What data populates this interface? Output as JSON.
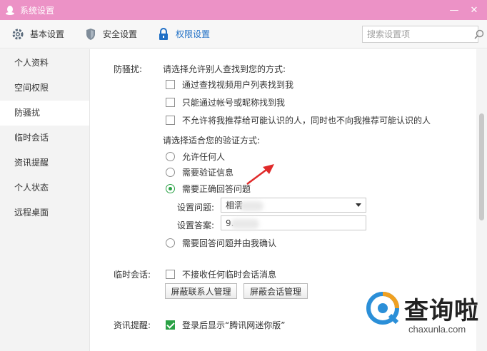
{
  "window": {
    "title": "系统设置",
    "minimize": "—",
    "close": "✕"
  },
  "toolbar": {
    "items": [
      {
        "label": "基本设置",
        "icon": "gear-icon"
      },
      {
        "label": "安全设置",
        "icon": "shield-icon"
      },
      {
        "label": "权限设置",
        "icon": "lock-icon",
        "active": true
      }
    ],
    "search_placeholder": "搜索设置项"
  },
  "sidebar": {
    "items": [
      {
        "label": "个人资料"
      },
      {
        "label": "空间权限"
      },
      {
        "label": "防骚扰",
        "active": true
      },
      {
        "label": "临时会话"
      },
      {
        "label": "资讯提醒"
      },
      {
        "label": "个人状态"
      },
      {
        "label": "远程桌面"
      }
    ]
  },
  "anti_harass": {
    "label": "防骚扰:",
    "find_prompt": "请选择允许别人查找到您的方式:",
    "find_options": [
      "通过查找视频用户列表找到我",
      "只能通过帐号或昵称找到我",
      "不允许将我推荐给可能认识的人，同时也不向我推荐可能认识的人"
    ],
    "verify_prompt": "请选择适合您的验证方式:",
    "verify_options": [
      "允许任何人",
      "需要验证信息",
      "需要正确回答问题",
      "需要回答问题并由我确认"
    ],
    "question_label": "设置问题:",
    "question_value": "相濡",
    "answer_label": "设置答案:",
    "answer_value": "9."
  },
  "temp_session": {
    "label": "临时会话:",
    "checkbox_label": "不接收任何临时会话消息",
    "buttons": [
      "屏蔽联系人管理",
      "屏蔽会话管理"
    ]
  },
  "news": {
    "label": "资讯提醒:",
    "checkbox_label": "登录后显示“腾讯网迷你版”"
  },
  "watermark": {
    "brand": "查询啦",
    "url": "chaxunla.com"
  },
  "colors": {
    "titlebar": "#ec92c6",
    "accent": "#1f6fc5",
    "check": "#2aa145",
    "arrow": "#e02a2a"
  }
}
